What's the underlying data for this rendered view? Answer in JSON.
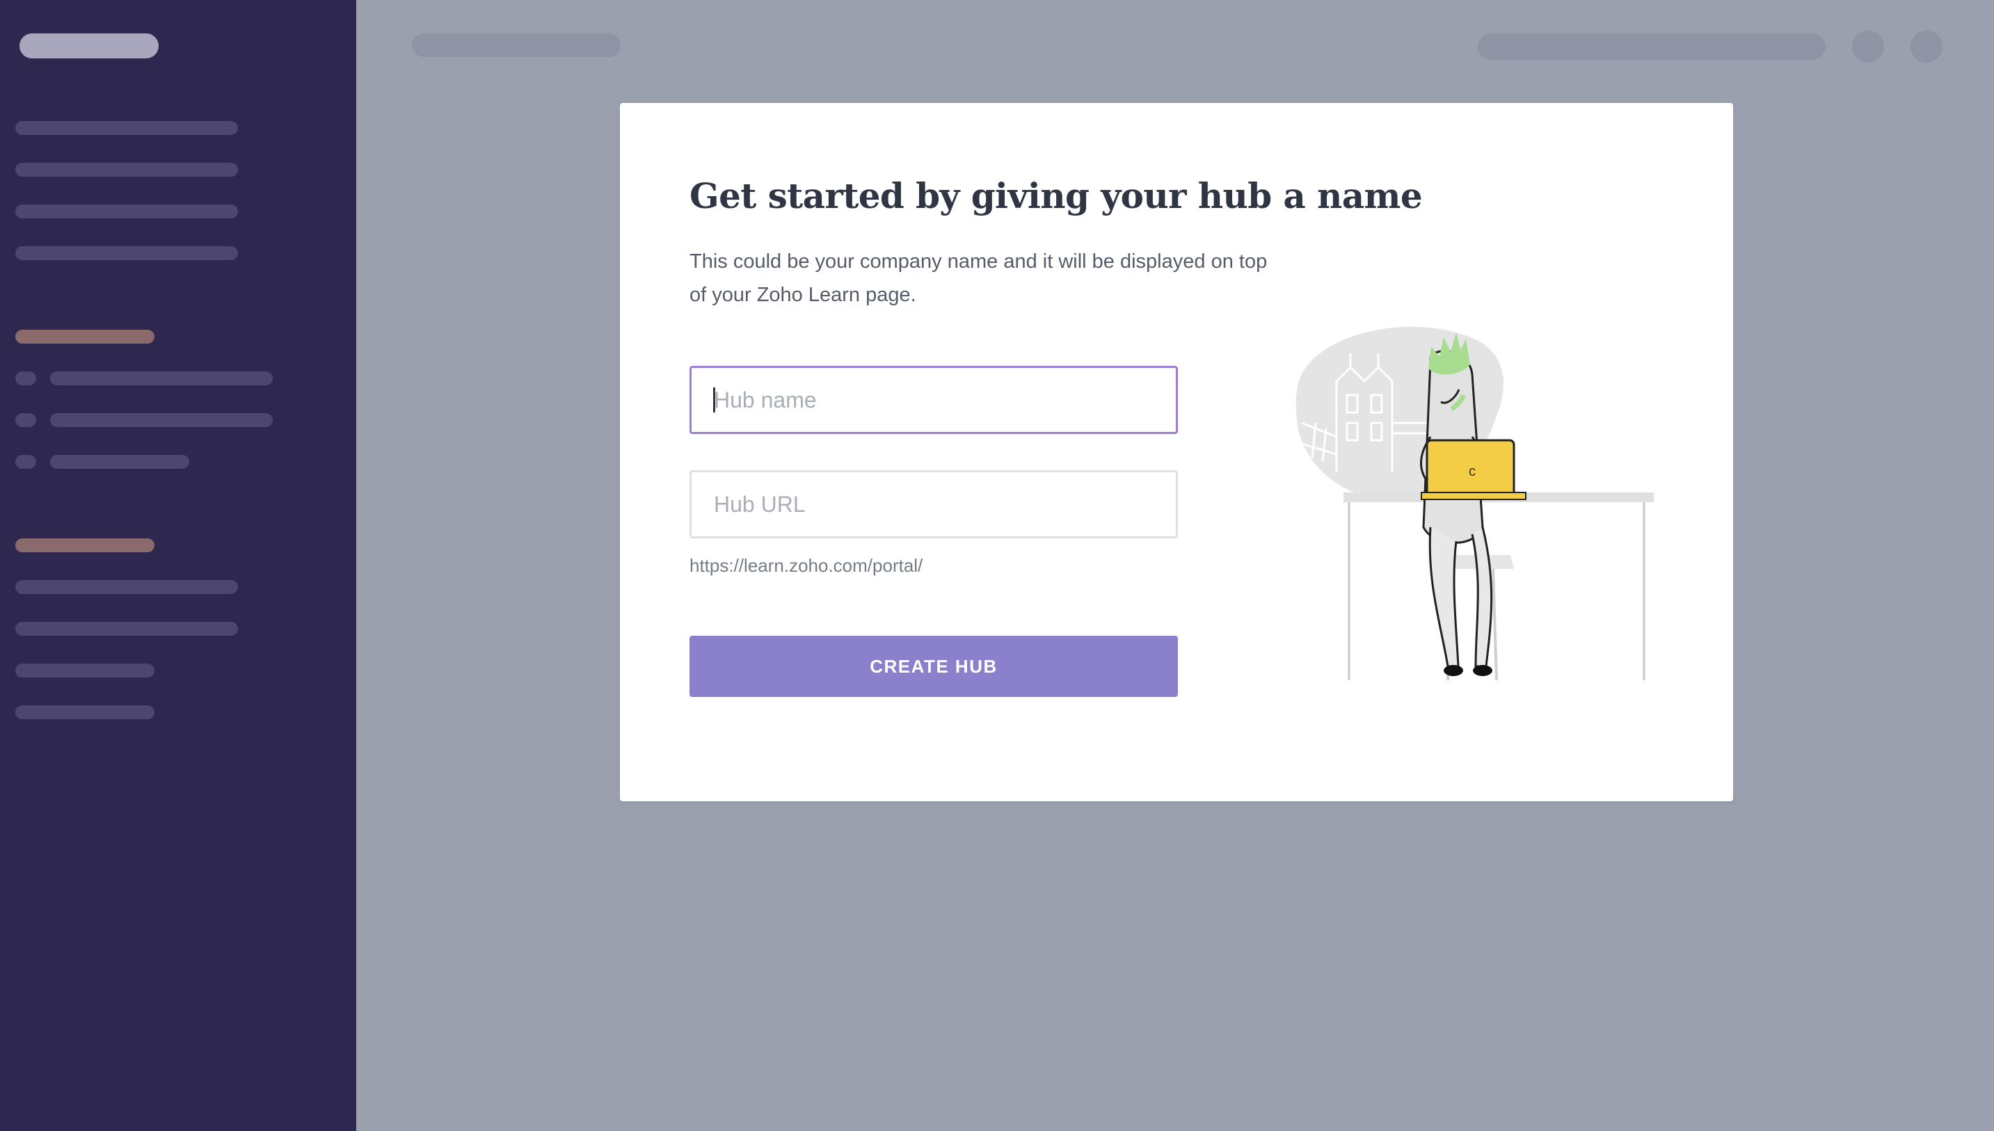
{
  "modal": {
    "title": "Get started by giving your hub a name",
    "description": "This could be your company name and it will be displayed on top of your Zoho Learn page.",
    "hub_name_placeholder": "Hub name",
    "hub_url_placeholder": "Hub URL",
    "url_prefix": "https://learn.zoho.com/portal/",
    "create_button_label": "CREATE HUB",
    "illustration_name": "person-with-laptop-illustration"
  },
  "colors": {
    "sidebar_bg": "#2e2850",
    "page_bg": "#9aa0ae",
    "accent": "#8a80cb",
    "focus_border": "#9b7fd4",
    "laptop_yellow": "#f2cd45",
    "hair_green": "#a8dc8e"
  }
}
